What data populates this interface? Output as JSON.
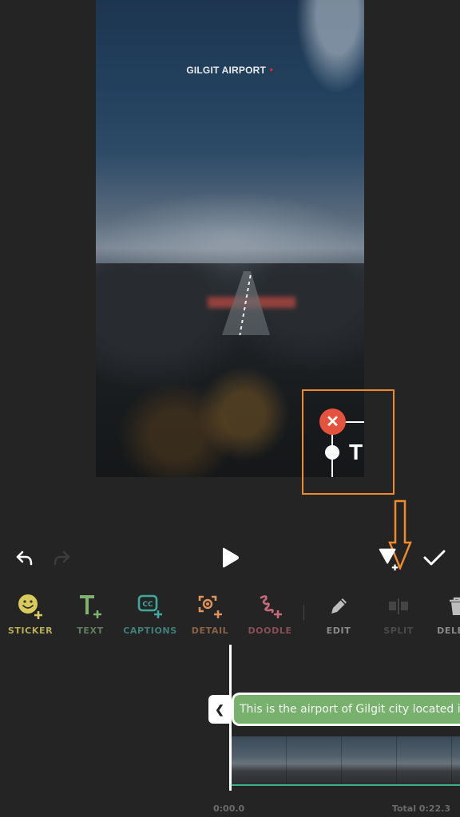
{
  "preview": {
    "overlay_title": "GILGIT AIRPORT",
    "overlay_pin_icon": "location-pin-icon"
  },
  "preview_controls": {
    "close_icon": "close-icon",
    "close_glyph": "✕",
    "text_glyph": "T"
  },
  "playback": {
    "undo_icon": "undo-icon",
    "redo_icon": "redo-icon",
    "play_icon": "play-icon",
    "add_marker_icon": "add-marker-icon",
    "confirm_icon": "checkmark-icon"
  },
  "tools": [
    {
      "label": "STICKER",
      "icon": "sticker-add-icon",
      "color": "#b5ac55"
    },
    {
      "label": "TEXT",
      "icon": "text-add-icon",
      "color": "#5f7d5c"
    },
    {
      "label": "CAPTIONS",
      "icon": "captions-add-icon",
      "color": "#3f7f78"
    },
    {
      "label": "DETAIL",
      "icon": "detail-add-icon",
      "color": "#8a6248"
    },
    {
      "label": "DOODLE",
      "icon": "doodle-add-icon",
      "color": "#8a4e58"
    },
    {
      "label": "EDIT",
      "icon": "pencil-icon",
      "color": "#8a8a8a"
    },
    {
      "label": "SPLIT",
      "icon": "split-icon",
      "color": "#4a4a4a"
    },
    {
      "label": "DELETE",
      "icon": "trash-icon",
      "color": "#8a8a8a"
    }
  ],
  "timeline": {
    "collapse_glyph": "❮",
    "text_clip": "This is the airport of Gilgit city located in",
    "current_time": "0:00.0",
    "total_time": "Total 0:22.3"
  },
  "colors": {
    "accent_orange": "#f08a2a",
    "close_red": "#e5533e",
    "clip_green": "#78b06d",
    "timeline_line": "#3bb08a"
  }
}
